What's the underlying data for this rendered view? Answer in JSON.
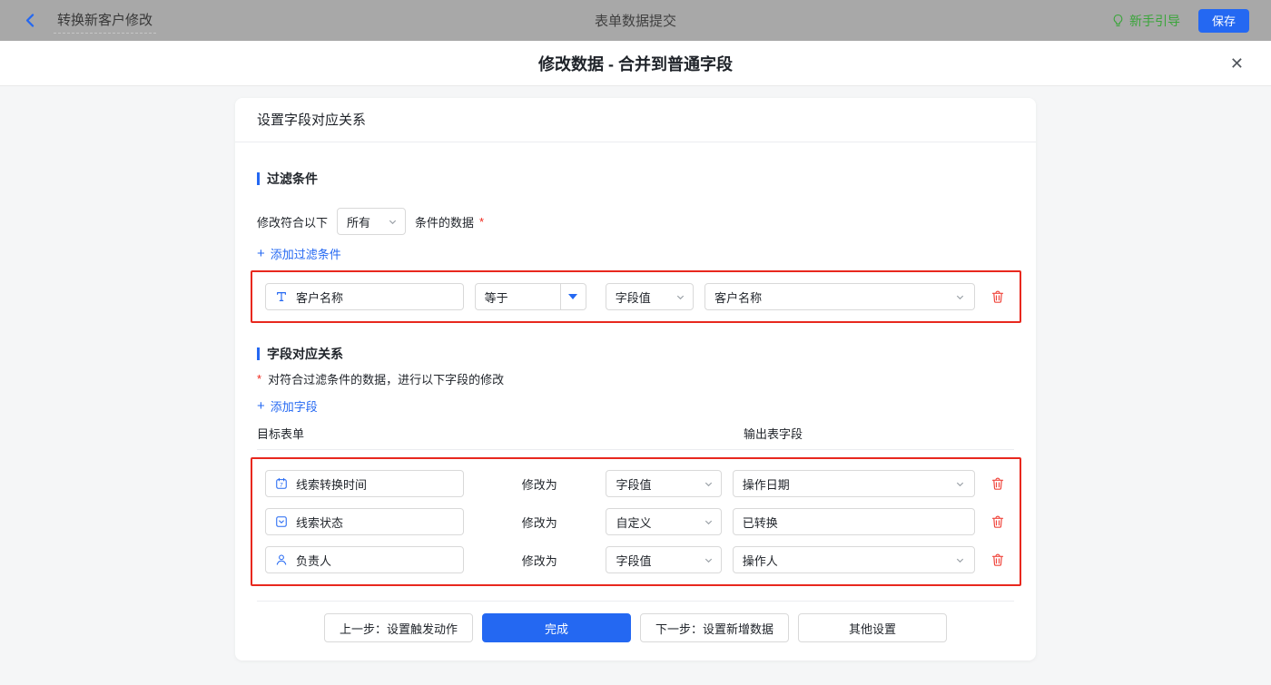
{
  "topbar": {
    "back_title": "转换新客户修改",
    "center_title": "表单数据提交",
    "guide_label": "新手引导",
    "save_label": "保存"
  },
  "dialog": {
    "title": "修改数据 - 合并到普通字段",
    "close_glyph": "✕"
  },
  "panel": {
    "header": "设置字段对应关系"
  },
  "filter": {
    "title": "过滤条件",
    "match_prefix": "修改符合以下",
    "match_value": "所有",
    "match_suffix": "条件的数据",
    "required_mark": "*",
    "plus": "+",
    "add_label": "添加过滤条件",
    "row": {
      "field": "客户名称",
      "operator": "等于",
      "value_type": "字段值",
      "value": "客户名称"
    }
  },
  "mapping": {
    "title": "字段对应关系",
    "required_mark": "*",
    "description": "对符合过滤条件的数据，进行以下字段的修改",
    "plus": "+",
    "add_label": "添加字段",
    "col_target": "目标表单",
    "col_output": "输出表字段",
    "modify_label": "修改为",
    "rows": [
      {
        "field": "线索转换时间",
        "type": "字段值",
        "value": "操作日期"
      },
      {
        "field": "线索状态",
        "type": "自定义",
        "value": "已转换"
      },
      {
        "field": "负责人",
        "type": "字段值",
        "value": "操作人"
      }
    ]
  },
  "footer": {
    "prev": "上一步：设置触发动作",
    "done": "完成",
    "next": "下一步：设置新增数据",
    "other": "其他设置"
  },
  "colors": {
    "primary_blue": "#2468f2",
    "guide_green": "#3aa53a",
    "highlight_red": "#e8281e",
    "trash_red": "#f0483f"
  }
}
